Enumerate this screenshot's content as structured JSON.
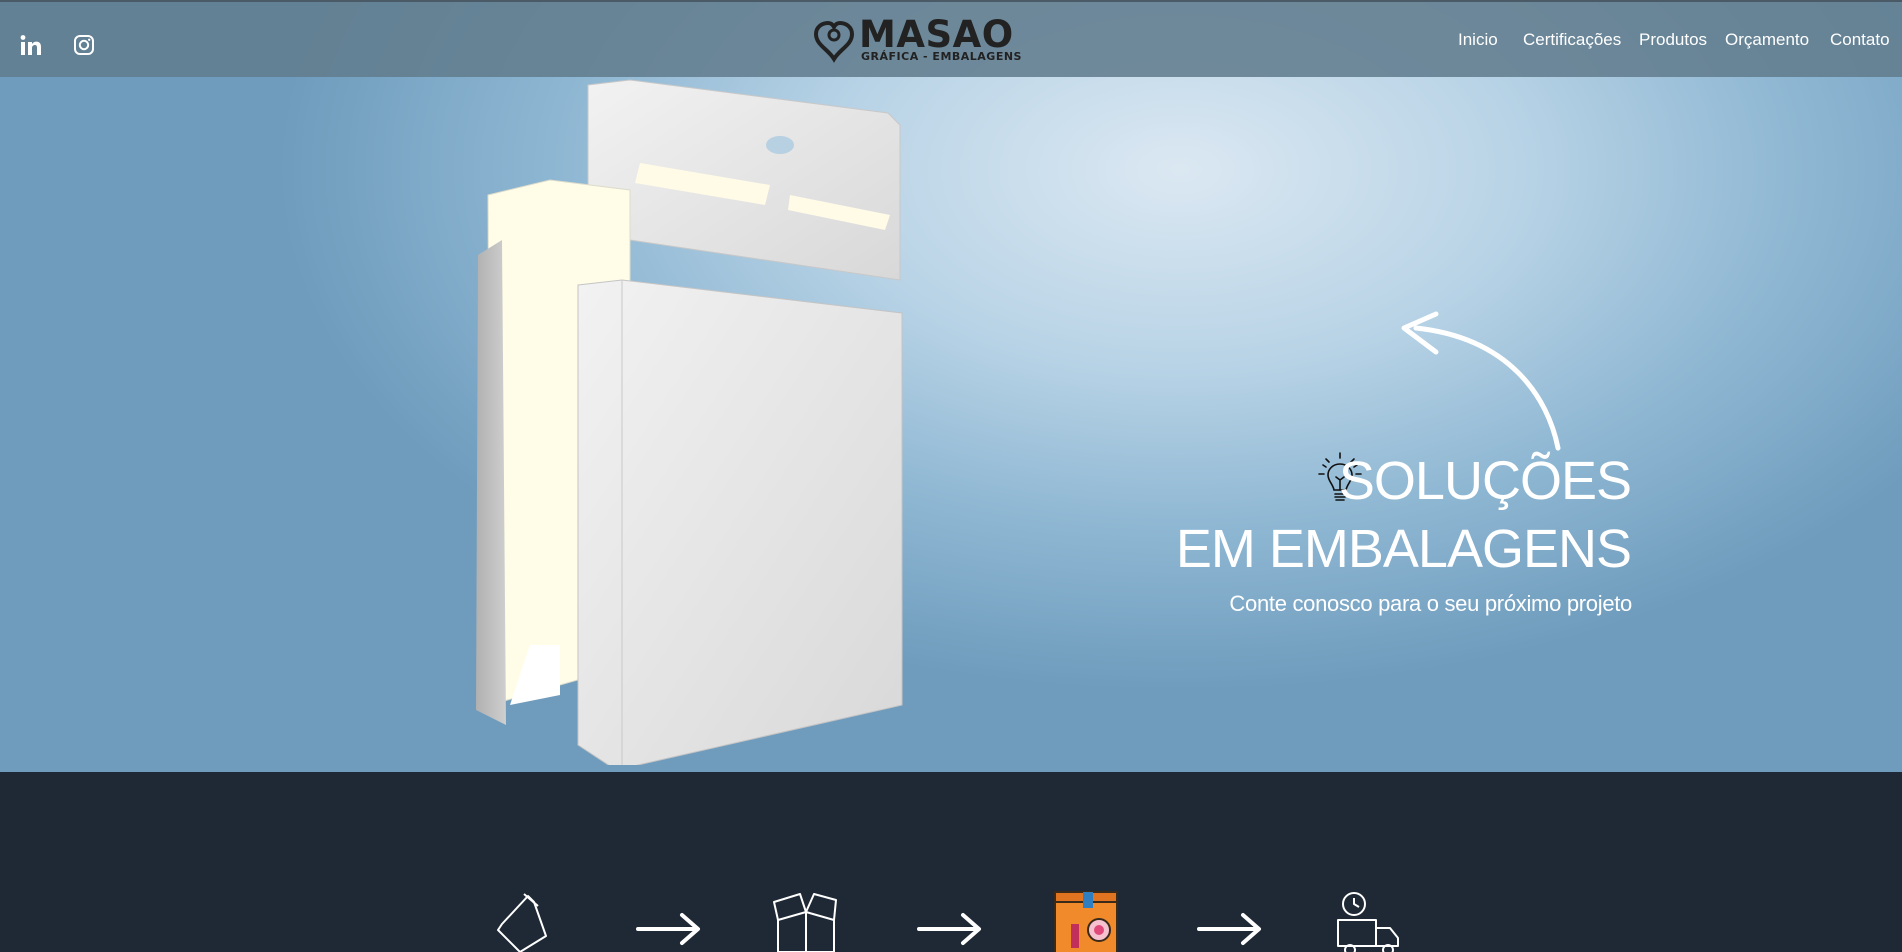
{
  "header": {
    "social": [
      {
        "name": "LinkedIn",
        "icon": "linkedin-icon"
      },
      {
        "name": "Instagram",
        "icon": "instagram-icon"
      }
    ],
    "logo": {
      "word": "MASAO",
      "tagline": "GRÁFICA - EMBALAGENS"
    },
    "nav": [
      "Inicio",
      "Certificações",
      "Produtos",
      "Orçamento",
      "Contato"
    ]
  },
  "hero": {
    "title_line1": "SOLUÇÕES",
    "title_line2": "EM EMBALAGENS",
    "subtitle": "Conte conosco para o seu próximo projeto",
    "icons": [
      "lightbulb-icon",
      "curved-arrow-icon"
    ]
  },
  "process": {
    "steps": [
      "tube-icon",
      "open-box-icon",
      "cosmetics-box-icon",
      "delivery-truck-icon"
    ],
    "connector_icon": "right-arrow-icon"
  },
  "colors": {
    "topbar": "#627d8e",
    "footer_bg": "#1e2935",
    "text": "#ffffff",
    "accent_orange": "#f08a2a"
  }
}
